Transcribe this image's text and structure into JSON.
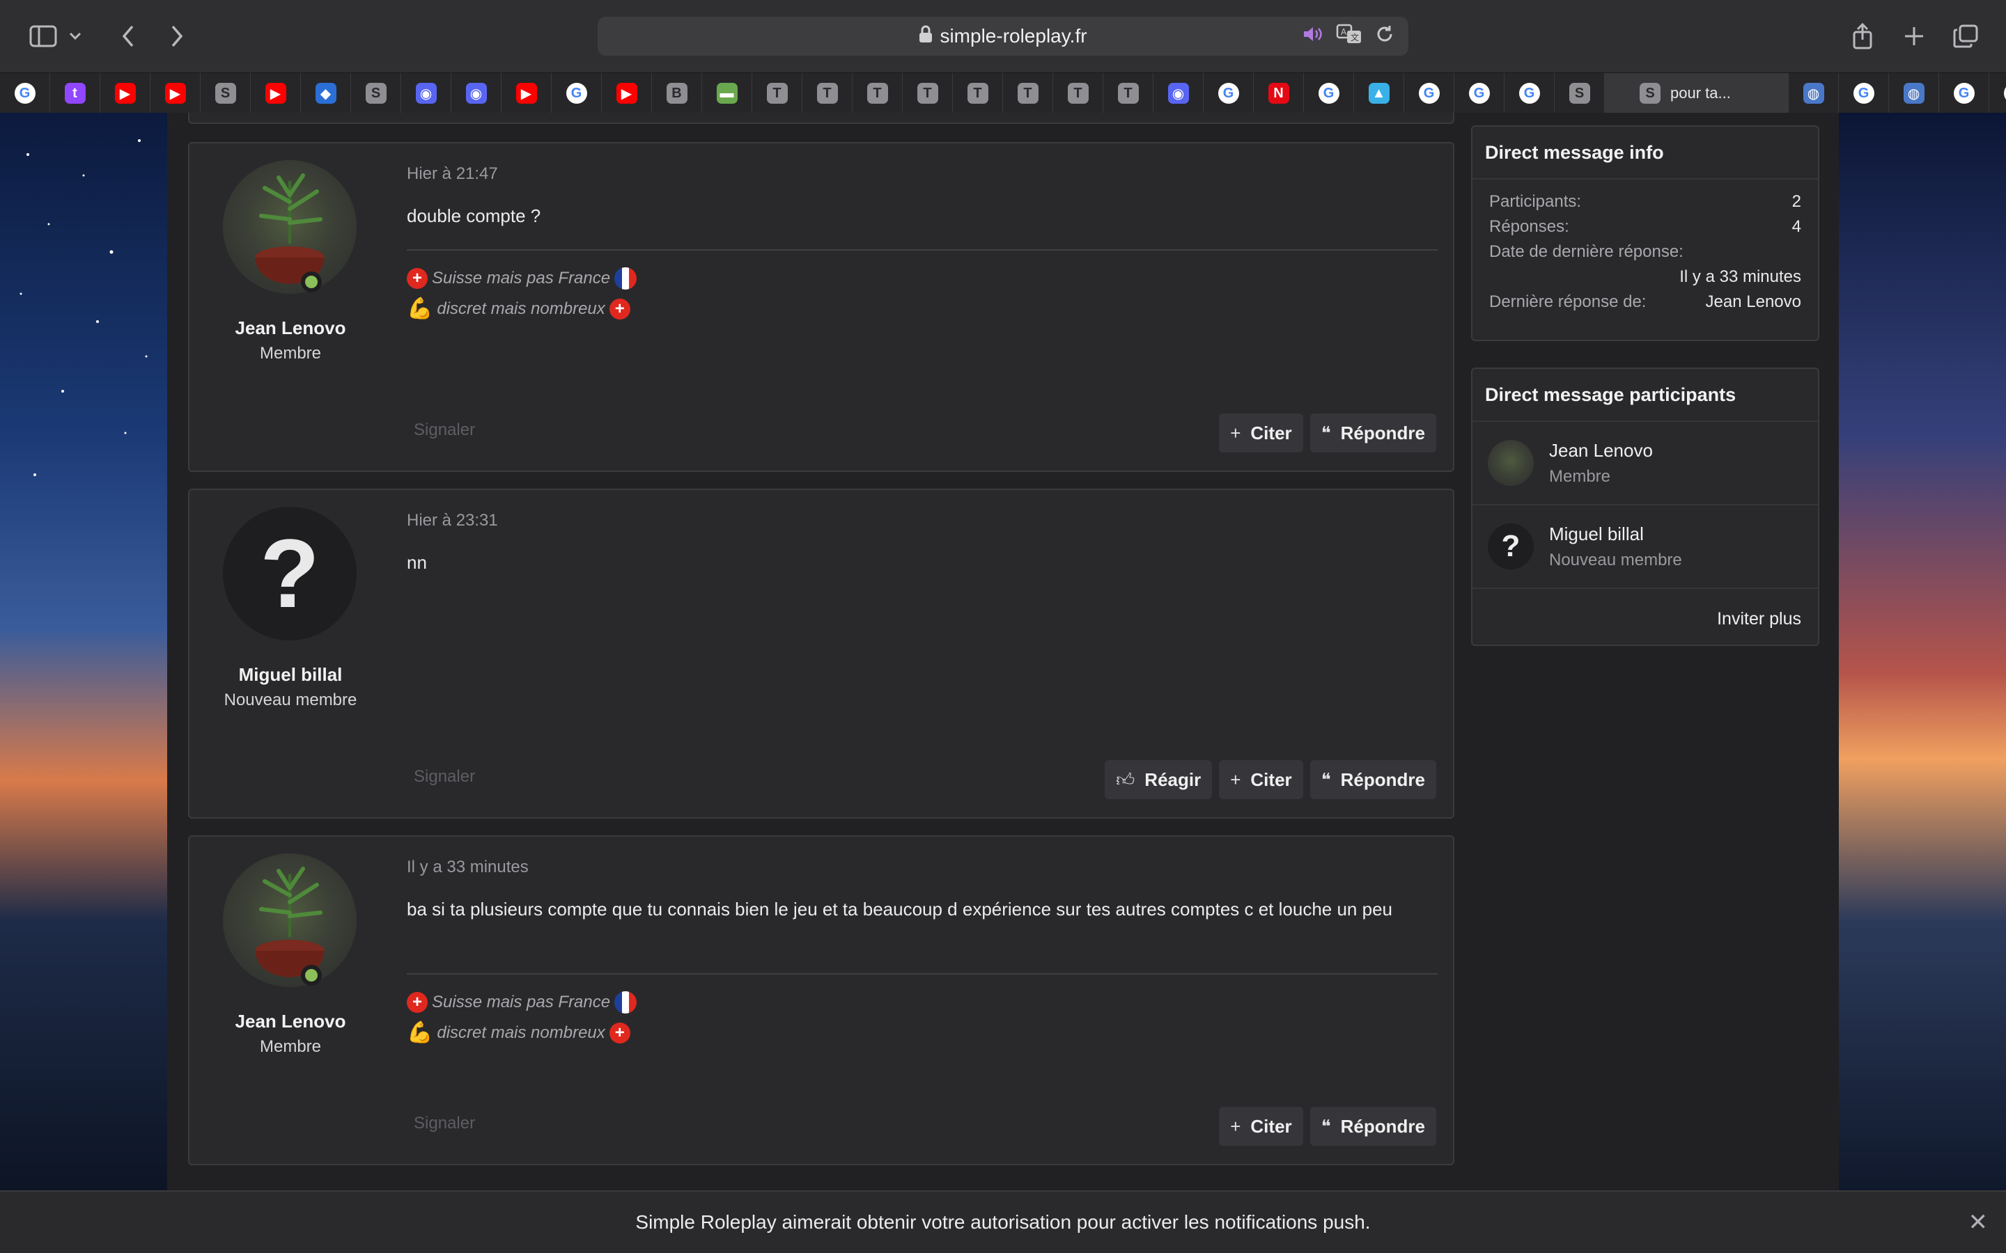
{
  "browser": {
    "url": "simple-roleplay.fr",
    "active_tab_title": "pour ta...",
    "tabs": [
      {
        "icon": "google-icon",
        "letter": "G",
        "color": "#ffffff"
      },
      {
        "icon": "twitch-icon",
        "letter": "t",
        "color": "#9146ff"
      },
      {
        "icon": "youtube-icon",
        "letter": "▶",
        "color": "#ff0000"
      },
      {
        "icon": "youtube-icon",
        "letter": "▶",
        "color": "#ff0000"
      },
      {
        "icon": "site-s-icon",
        "letter": "S",
        "color": "#8e8e93"
      },
      {
        "icon": "youtube-icon",
        "letter": "▶",
        "color": "#ff0000"
      },
      {
        "icon": "shape-icon",
        "letter": "◆",
        "color": "#2b6fd6"
      },
      {
        "icon": "site-s-icon",
        "letter": "S",
        "color": "#8e8e93"
      },
      {
        "icon": "discord-icon",
        "letter": "◉",
        "color": "#5865f2"
      },
      {
        "icon": "discord-icon",
        "letter": "◉",
        "color": "#5865f2"
      },
      {
        "icon": "youtube-icon",
        "letter": "▶",
        "color": "#ff0000"
      },
      {
        "icon": "google-icon",
        "letter": "G",
        "color": "#ffffff"
      },
      {
        "icon": "youtube-icon",
        "letter": "▶",
        "color": "#ff0000"
      },
      {
        "icon": "site-b-icon",
        "letter": "B",
        "color": "#8e8e93"
      },
      {
        "icon": "landscape-icon",
        "letter": "▬",
        "color": "#6aa84f"
      },
      {
        "icon": "site-t-icon",
        "letter": "T",
        "color": "#8e8e93"
      },
      {
        "icon": "site-t-icon",
        "letter": "T",
        "color": "#8e8e93"
      },
      {
        "icon": "site-t-icon",
        "letter": "T",
        "color": "#8e8e93"
      },
      {
        "icon": "site-t-icon",
        "letter": "T",
        "color": "#8e8e93"
      },
      {
        "icon": "site-t-icon",
        "letter": "T",
        "color": "#8e8e93"
      },
      {
        "icon": "site-t-icon",
        "letter": "T",
        "color": "#8e8e93"
      },
      {
        "icon": "site-t-icon",
        "letter": "T",
        "color": "#8e8e93"
      },
      {
        "icon": "site-t-icon",
        "letter": "T",
        "color": "#8e8e93"
      },
      {
        "icon": "discord-icon",
        "letter": "◉",
        "color": "#5865f2"
      },
      {
        "icon": "google-icon",
        "letter": "G",
        "color": "#ffffff"
      },
      {
        "icon": "netflix-icon",
        "letter": "N",
        "color": "#e50914"
      },
      {
        "icon": "google-icon",
        "letter": "G",
        "color": "#ffffff"
      },
      {
        "icon": "triangle-icon",
        "letter": "▲",
        "color": "#3ab0e8"
      },
      {
        "icon": "google-icon",
        "letter": "G",
        "color": "#ffffff"
      },
      {
        "icon": "google-icon",
        "letter": "G",
        "color": "#ffffff"
      },
      {
        "icon": "google-icon",
        "letter": "G",
        "color": "#ffffff"
      },
      {
        "icon": "site-s-icon",
        "letter": "S",
        "color": "#8e8e93"
      }
    ],
    "tabs_after": [
      {
        "icon": "globe-icon",
        "letter": "◍",
        "color": "#4a78c8"
      },
      {
        "icon": "google-icon",
        "letter": "G",
        "color": "#ffffff"
      },
      {
        "icon": "globe-icon",
        "letter": "◍",
        "color": "#4a78c8"
      },
      {
        "icon": "google-icon",
        "letter": "G",
        "color": "#ffffff"
      },
      {
        "icon": "google-icon",
        "letter": "G",
        "color": "#ffffff"
      }
    ]
  },
  "posts": [
    {
      "author": "Jean Lenovo",
      "role": "Membre",
      "avatar": "plant",
      "online": true,
      "date": "Hier à 21:47",
      "text": "double compte ?",
      "signature": true,
      "report": "Signaler",
      "buttons": [
        "Citer",
        "Répondre"
      ]
    },
    {
      "author": "Miguel billal",
      "role": "Nouveau membre",
      "avatar": "unknown",
      "online": false,
      "date": "Hier à 23:31",
      "text": "nn",
      "signature": false,
      "report": "Signaler",
      "buttons": [
        "Réagir",
        "Citer",
        "Répondre"
      ]
    },
    {
      "author": "Jean Lenovo",
      "role": "Membre",
      "avatar": "plant",
      "online": true,
      "date": "Il y a 33 minutes",
      "text": "ba si ta plusieurs compte que tu connais bien le jeu et ta beaucoup d expérience sur tes autres comptes c et louche un peu",
      "signature": true,
      "report": "Signaler",
      "buttons": [
        "Citer",
        "Répondre"
      ]
    }
  ],
  "signature": {
    "line1": "Suisse mais pas France",
    "line2": "discret mais nombreux"
  },
  "sidebar": {
    "info_title": "Direct message info",
    "participants_label": "Participants:",
    "participants_value": "2",
    "replies_label": "Réponses:",
    "replies_value": "4",
    "last_date_label": "Date de dernière réponse:",
    "last_date_value": "Il y a 33 minutes",
    "last_by_label": "Dernière réponse de:",
    "last_by_value": "Jean Lenovo",
    "participants_title": "Direct message participants",
    "participants": [
      {
        "name": "Jean Lenovo",
        "role": "Membre",
        "avatar": "plant"
      },
      {
        "name": "Miguel billal",
        "role": "Nouveau membre",
        "avatar": "unknown"
      }
    ],
    "invite": "Inviter plus"
  },
  "notification": {
    "text": "Simple Roleplay aimerait obtenir votre autorisation pour activer les notifications push.",
    "close": "✕"
  }
}
